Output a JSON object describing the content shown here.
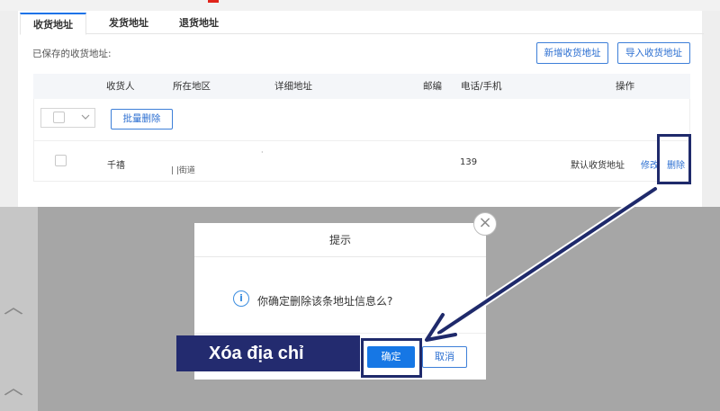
{
  "tabs": [
    {
      "label": "收货地址",
      "active": true
    },
    {
      "label": "发货地址",
      "active": false
    },
    {
      "label": "退货地址",
      "active": false
    }
  ],
  "saved_label": "已保存的收货地址:",
  "buttons": {
    "add_address": "新增收货地址",
    "import_address": "导入收货地址",
    "batch_delete": "批量删除"
  },
  "table": {
    "headers": [
      "收货人",
      "所在地区",
      "详细地址",
      "邮编",
      "电话/手机",
      "操作"
    ],
    "rows": [
      {
        "receiver": "千禧",
        "region": "| |街道",
        "detail": "·",
        "postcode": "",
        "phone": "139",
        "default_label": "默认收货地址",
        "edit": "修改",
        "delete": "删除"
      }
    ]
  },
  "dialog": {
    "title": "提示",
    "message": "你确定删除该条地址信息么?",
    "ok": "确定",
    "cancel": "取消"
  },
  "annotation": {
    "text": "Xóa địa chỉ",
    "color": "#232b6f"
  },
  "colors": {
    "accent": "#1677e5",
    "link": "#2c6fd1",
    "overlay": "#a6a6a6",
    "annotation_box": "#1f2a6b"
  },
  "icons": {
    "info": "info-circle-icon",
    "close": "close-circle-icon",
    "dropdown": "chevron-down-icon",
    "scroll_up": "chevron-up-icon"
  }
}
